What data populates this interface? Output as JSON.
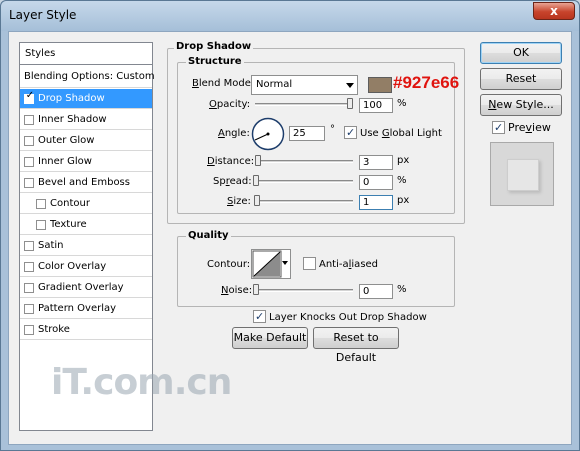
{
  "window": {
    "title": "Layer Style",
    "close_glyph": "x"
  },
  "styles_list": {
    "header": "Styles",
    "blending": "Blending Options: Custom",
    "items": [
      {
        "label": "Drop Shadow",
        "checked": true,
        "selected": true
      },
      {
        "label": "Inner Shadow",
        "checked": false
      },
      {
        "label": "Outer Glow",
        "checked": false
      },
      {
        "label": "Inner Glow",
        "checked": false
      },
      {
        "label": "Bevel and Emboss",
        "checked": false
      },
      {
        "label": "Contour",
        "checked": false
      },
      {
        "label": "Texture",
        "checked": false
      },
      {
        "label": "Satin",
        "checked": false
      },
      {
        "label": "Color Overlay",
        "checked": false
      },
      {
        "label": "Gradient Overlay",
        "checked": false
      },
      {
        "label": "Pattern Overlay",
        "checked": false
      },
      {
        "label": "Stroke",
        "checked": false
      }
    ]
  },
  "drop_shadow": {
    "title": "Drop Shadow",
    "structure": {
      "title": "Structure",
      "blend_mode_label_prefix": "B",
      "blend_mode_label_rest": "lend Mode:",
      "blend_mode_value": "Normal",
      "shadow_color": "#927e66",
      "opacity_label_prefix": "O",
      "opacity_label_rest": "pacity:",
      "opacity_value": "100",
      "opacity_unit": "%",
      "angle_label_prefix": "A",
      "angle_label_rest": "ngle:",
      "angle_value": "25",
      "angle_unit": "°",
      "global_light_label_pre": "Use ",
      "global_light_label_ul": "G",
      "global_light_label_rest": "lobal Light",
      "global_light_checked": true,
      "distance_label_prefix": "D",
      "distance_label_rest": "istance:",
      "distance_value": "3",
      "distance_unit": "px",
      "spread_label_pre": "Sp",
      "spread_label_ul": "r",
      "spread_label_rest": "ead:",
      "spread_value": "0",
      "spread_unit": "%",
      "size_label_prefix": "S",
      "size_label_rest": "ize:",
      "size_value": "1",
      "size_unit": "px"
    },
    "quality": {
      "title": "Quality",
      "contour_label": "Contour:",
      "anti_aliased_label_pre": "Anti-a",
      "anti_aliased_label_ul": "l",
      "anti_aliased_label_rest": "iased",
      "noise_label_prefix": "N",
      "noise_label_rest": "oise:",
      "noise_value": "0",
      "noise_unit": "%"
    },
    "knockout_label": "Layer Knocks Out Drop Shadow",
    "knockout_checked": true,
    "make_default_label": "Make Default",
    "reset_default_label": "Reset to Default"
  },
  "buttons": {
    "ok": "OK",
    "reset": "Reset",
    "new_style_prefix": "N",
    "new_style_rest": "ew Style...",
    "preview_label_prefix": "Pre",
    "preview_label_ul": "v",
    "preview_label_rest": "iew",
    "preview_checked": true
  },
  "annotation": {
    "text": "#927e66",
    "color": "#e0140f"
  },
  "watermark": {
    "text": "iT.com.cn"
  }
}
